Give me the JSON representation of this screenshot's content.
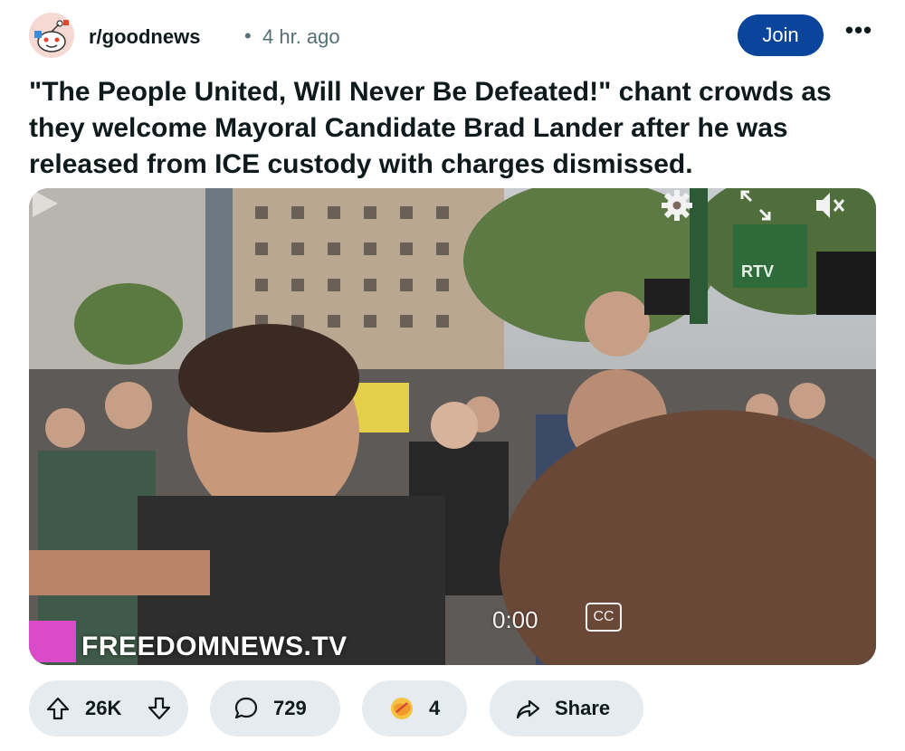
{
  "post": {
    "subreddit": "r/goodnews",
    "separator": "•",
    "time_ago": "4 hr. ago",
    "join_label": "Join",
    "more_label": "•••",
    "title": "\"The People United, Will Never Be Defeated!\" chant crowds as they welcome Mayoral Candidate Brad Lander after he was released from ICE custody with charges dismissed."
  },
  "video": {
    "watermark": "FREEDOMNEWS.TV",
    "channel_logo": "RTV",
    "timecode": "0:00",
    "cc_label": "CC",
    "controls": [
      "play-icon",
      "captions-icon",
      "settings-gear-icon",
      "fullscreen-icon",
      "muted-speaker-icon"
    ]
  },
  "actions": {
    "upvotes": "26K",
    "comments": "729",
    "awards": "4",
    "share_label": "Share"
  },
  "colors": {
    "join_bg": "#0a449b",
    "pill_bg": "#e5ebee",
    "muted_text": "#576f76"
  }
}
